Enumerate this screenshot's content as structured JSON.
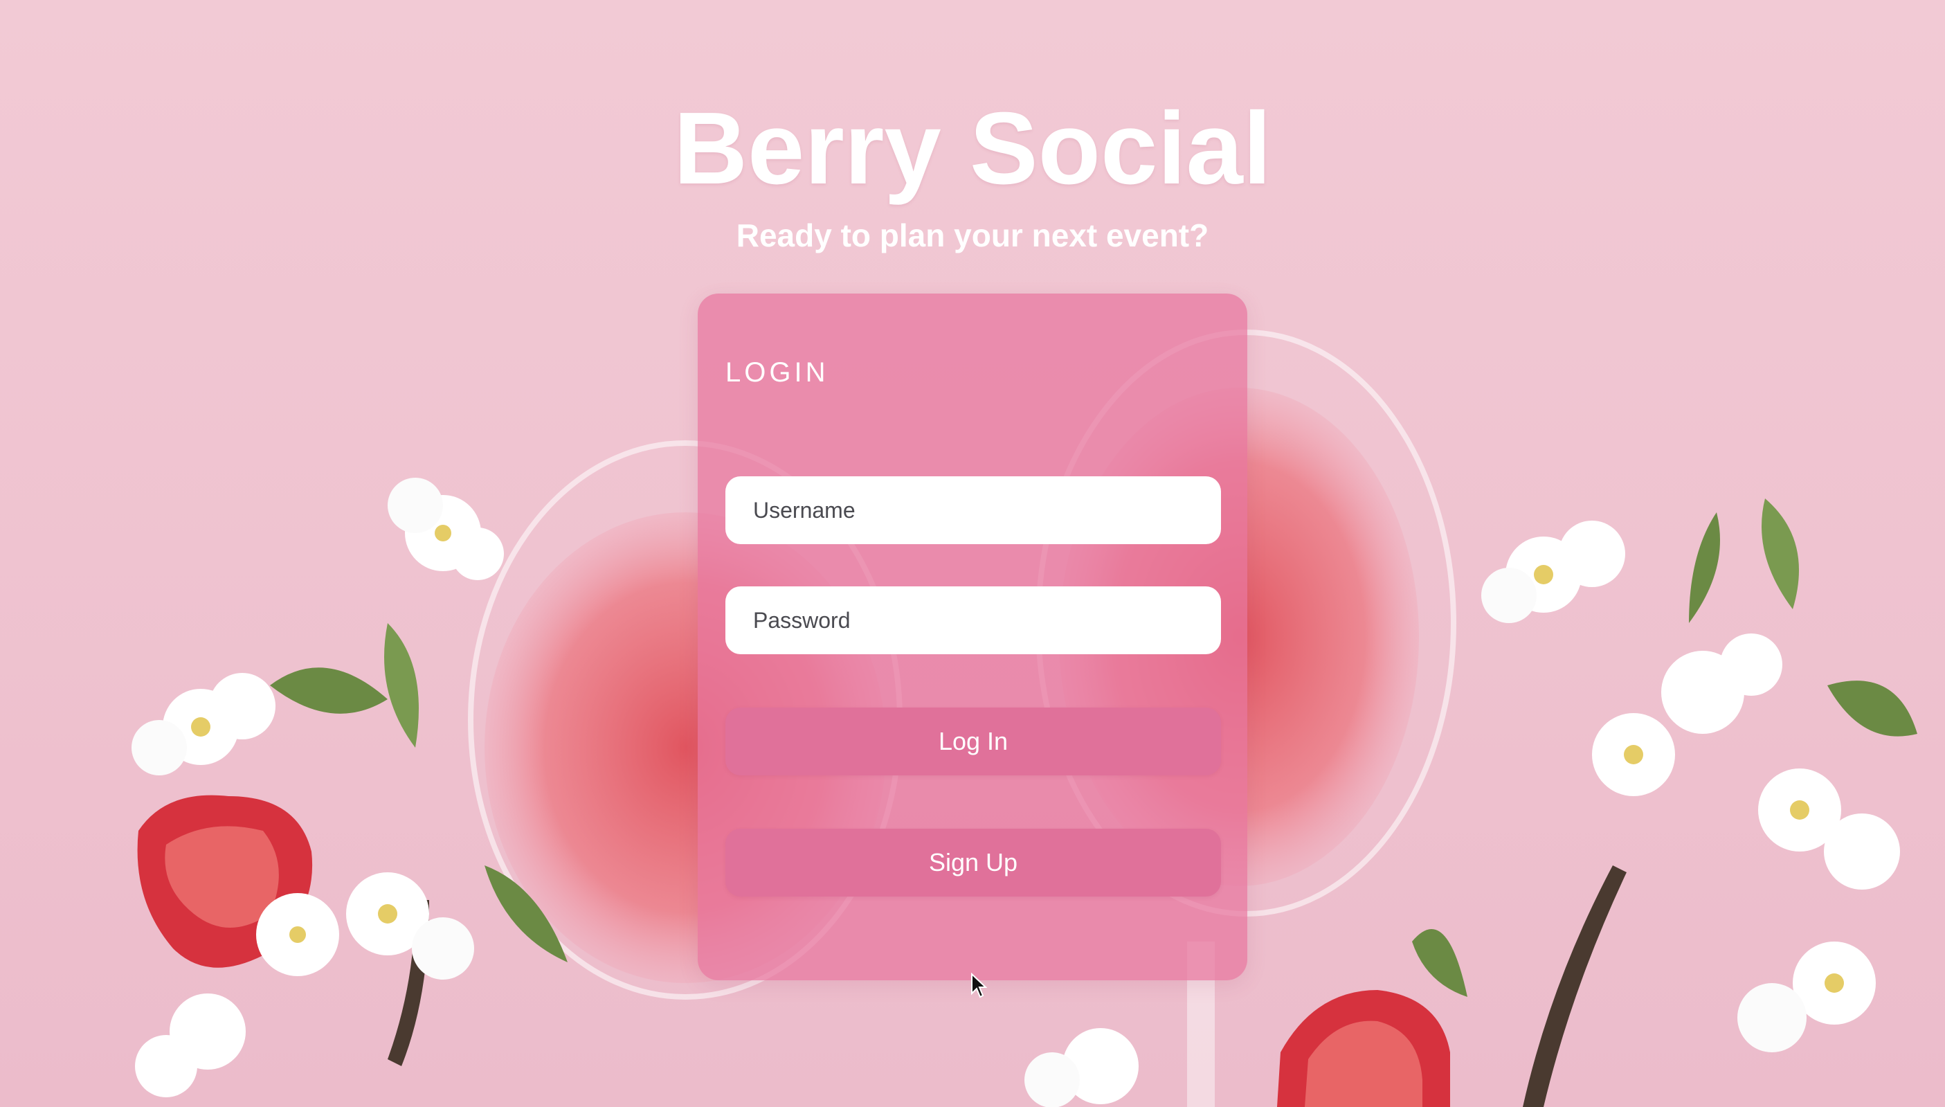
{
  "header": {
    "title": "Berry Social",
    "subtitle": "Ready to plan your next event?"
  },
  "login_card": {
    "heading": "LOGIN",
    "username_placeholder": "Username",
    "password_placeholder": "Password",
    "login_label": "Log In",
    "signup_label": "Sign Up"
  },
  "colors": {
    "background": "#f1c7d3",
    "card": "#e8769e",
    "button": "#e0719a",
    "text": "#ffffff"
  }
}
